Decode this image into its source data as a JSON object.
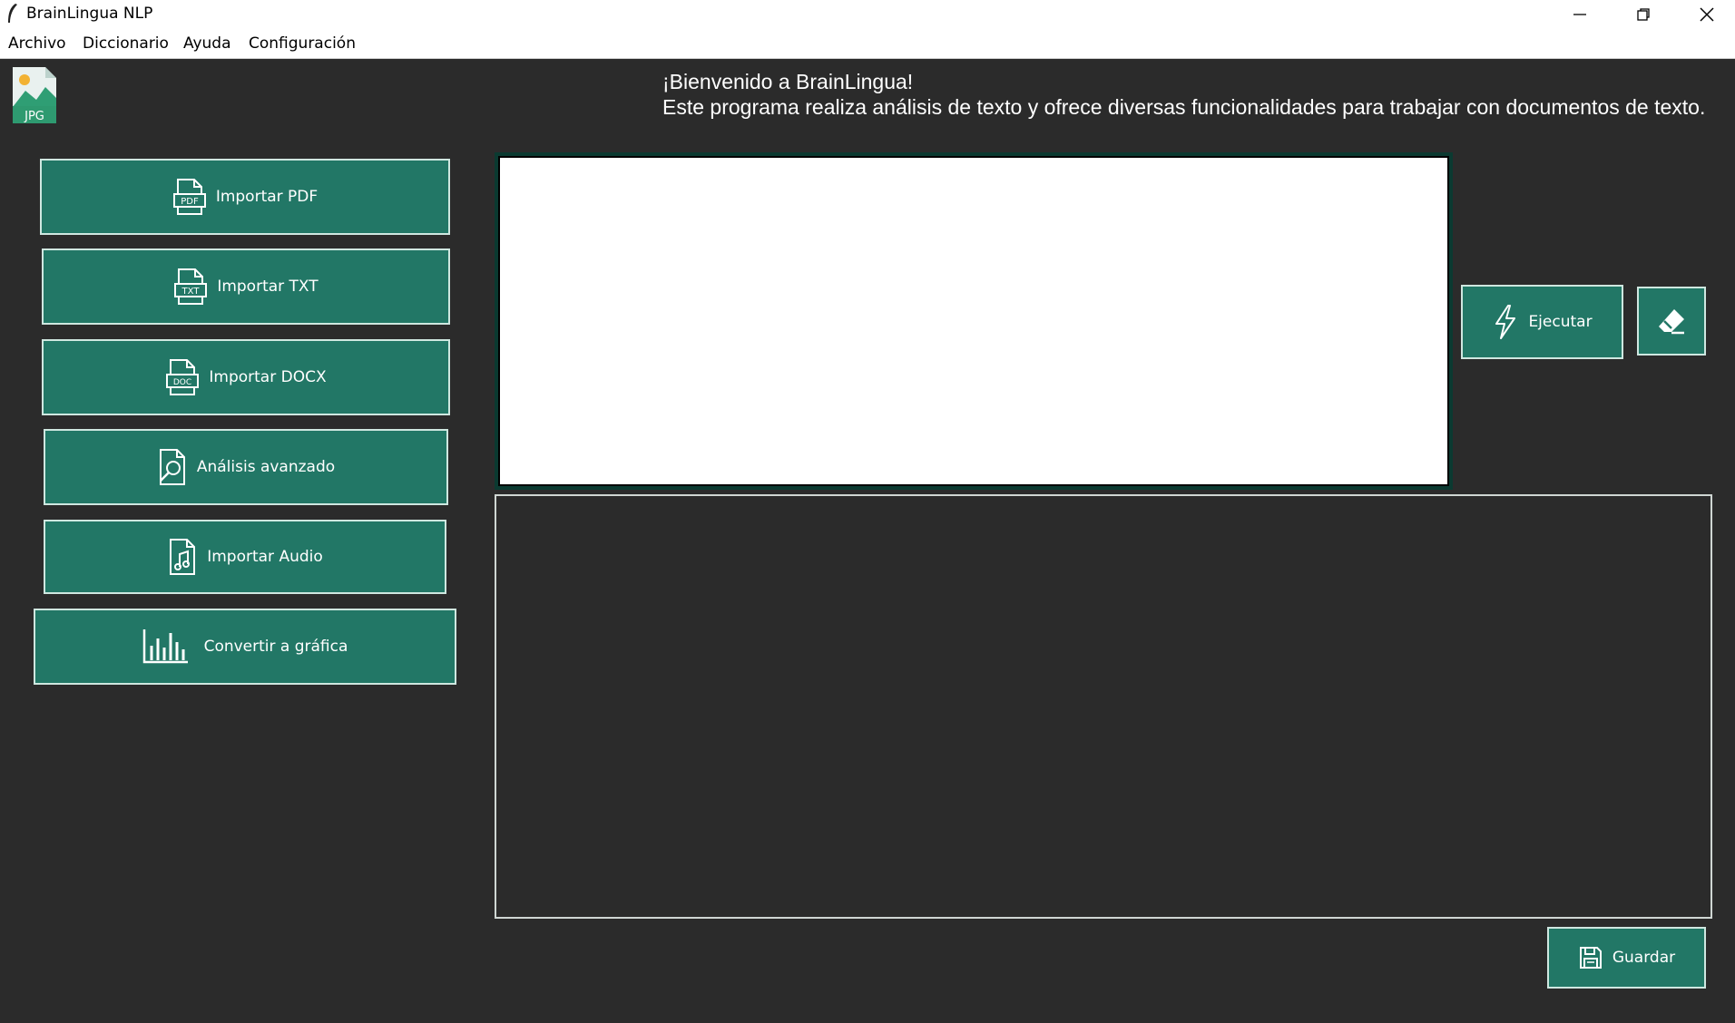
{
  "window": {
    "title": "BrainLingua NLP"
  },
  "menu": [
    "Archivo",
    "Diccionario",
    "Ayuda",
    "Configuración"
  ],
  "logo": {
    "label": "JPG"
  },
  "welcome": {
    "line1": "¡Bienvenido a BrainLingua!",
    "line2": "Este programa realiza análisis de texto y ofrece diversas funcionalidades para trabajar con documentos de texto."
  },
  "sidebar": {
    "buttons": [
      {
        "label": "Importar PDF",
        "icon": "pdf-file-icon"
      },
      {
        "label": "Importar TXT",
        "icon": "txt-file-icon"
      },
      {
        "label": "Importar DOCX",
        "icon": "docx-file-icon"
      },
      {
        "label": "Análisis avanzado",
        "icon": "file-search-icon"
      },
      {
        "label": "Importar Audio",
        "icon": "audio-file-icon"
      },
      {
        "label": "Convertir a gráfica",
        "icon": "bar-chart-icon"
      }
    ]
  },
  "actions": {
    "execute_label": "Ejecutar",
    "execute_icon": "lightning-icon",
    "clear_icon": "eraser-icon",
    "save_label": "Guardar",
    "save_icon": "floppy-disk-icon"
  },
  "colors": {
    "background": "#2b2b2b",
    "accent": "#227766",
    "button_border": "#cfe7e0"
  }
}
